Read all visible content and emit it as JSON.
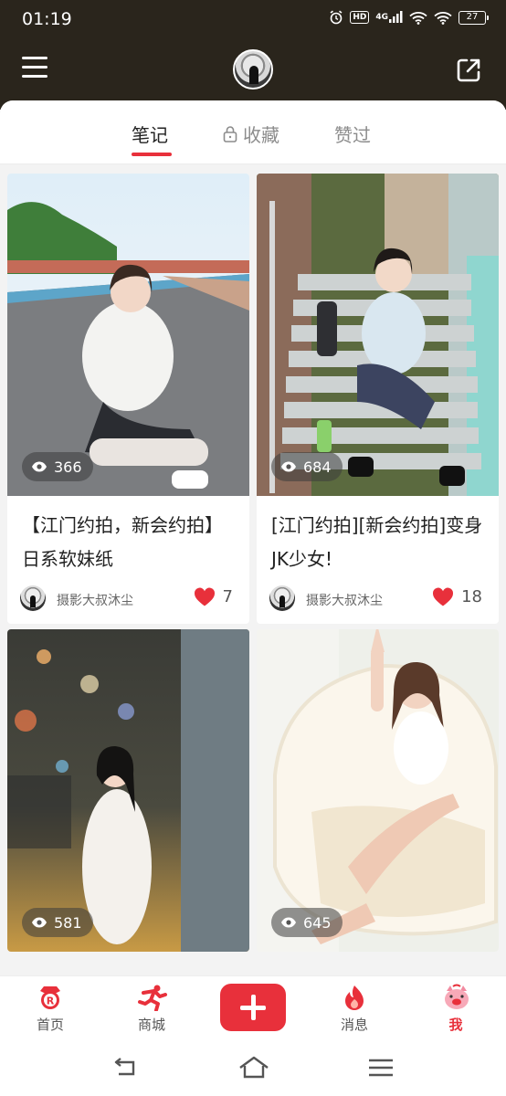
{
  "status_bar": {
    "time": "01:19",
    "hd": "HD",
    "network": "4G",
    "battery": "27"
  },
  "header": {
    "menu_icon": "hamburger-menu-icon",
    "avatar": "profile-avatar",
    "share_icon": "share-export-icon"
  },
  "tabs": [
    {
      "label": "笔记",
      "active": true
    },
    {
      "label": "收藏",
      "locked": true
    },
    {
      "label": "赞过"
    }
  ],
  "notes": [
    {
      "views": "366",
      "title": "【江门约拍，新会约拍】日系软妹纸",
      "author": "摄影大叔沐尘",
      "likes": "7"
    },
    {
      "views": "684",
      "title": "[江门约拍][新会约拍]变身JK少女!",
      "author": "摄影大叔沐尘",
      "likes": "18"
    },
    {
      "views": "581",
      "title": "",
      "author": "",
      "likes": ""
    },
    {
      "views": "645",
      "title": "",
      "author": "",
      "likes": ""
    }
  ],
  "bottom_nav": [
    {
      "label": "首页",
      "icon": "home-r-icon"
    },
    {
      "label": "商城",
      "icon": "shop-runner-icon"
    },
    {
      "label": "",
      "icon": "plus-icon"
    },
    {
      "label": "消息",
      "icon": "message-flame-icon"
    },
    {
      "label": "我",
      "icon": "me-pig-icon",
      "active": true
    }
  ],
  "colors": {
    "accent": "#e8303b",
    "header_bg": "#2a251c"
  }
}
